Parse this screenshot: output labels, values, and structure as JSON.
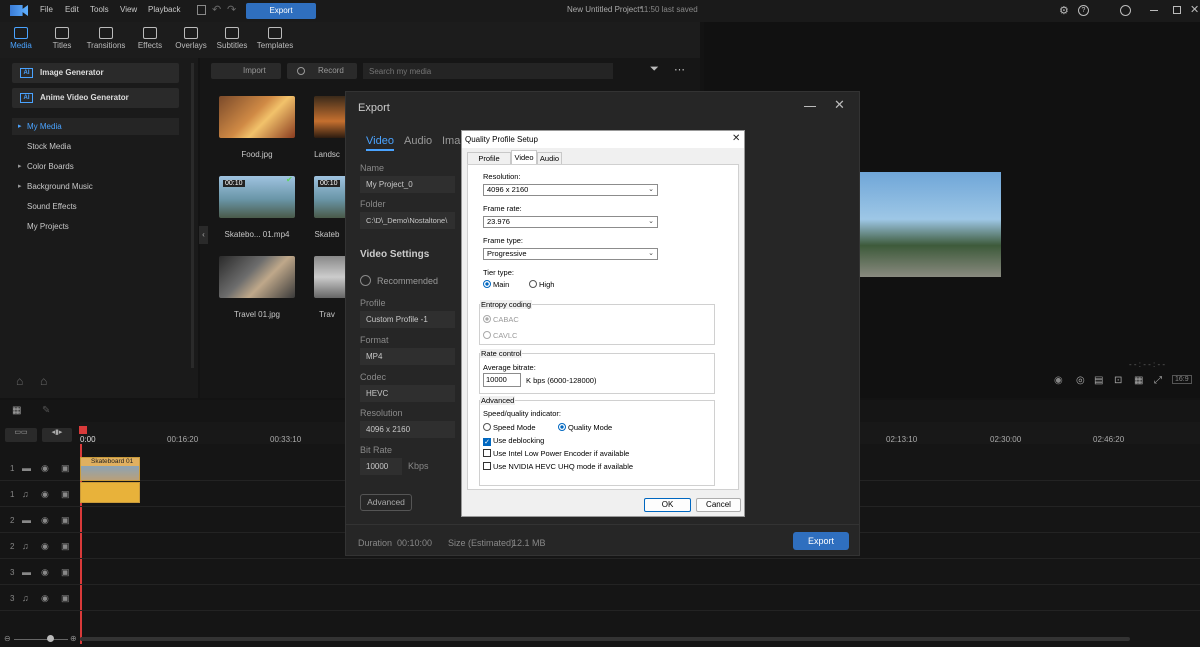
{
  "menubar": {
    "file": "File",
    "edit": "Edit",
    "tools": "Tools",
    "view": "View",
    "playback": "Playback",
    "export": "Export",
    "title": "New Untitled Project*",
    "saved": "11:50 last saved"
  },
  "tabs": [
    {
      "label": "Media"
    },
    {
      "label": "Titles"
    },
    {
      "label": "Transitions"
    },
    {
      "label": "Effects"
    },
    {
      "label": "Overlays"
    },
    {
      "label": "Subtitles"
    },
    {
      "label": "Templates"
    }
  ],
  "left": {
    "image_gen": "Image Generator",
    "anime_gen": "Anime Video Generator",
    "ai_badge": "AI",
    "nav": [
      "My Media",
      "Stock Media",
      "Color Boards",
      "Background Music",
      "Sound Effects",
      "My Projects"
    ]
  },
  "media": {
    "import": "Import",
    "record": "Record",
    "search_placeholder": "Search my media",
    "items": [
      {
        "name": "Food.jpg"
      },
      {
        "name": "Landsc"
      },
      {
        "name": "Skatebo... 01.mp4",
        "duration": "00:10"
      },
      {
        "name": "Skateb",
        "duration": "00:10"
      },
      {
        "name": "Travel 01.jpg"
      },
      {
        "name": "Trav"
      }
    ]
  },
  "timeline": {
    "times": [
      "0:00",
      "00:16:20",
      "00:33:10",
      "02:13:10",
      "02:30:00",
      "02:46:20"
    ],
    "clip": "Skateboard 01",
    "tracks": [
      "1",
      "1",
      "2",
      "2",
      "3",
      "3"
    ]
  },
  "export_dialog": {
    "title": "Export",
    "tabs": [
      "Video",
      "Audio",
      "Ima"
    ],
    "name_label": "Name",
    "name_value": "My Project_0",
    "folder_label": "Folder",
    "folder_value": "C:\\D\\_Demo\\Nostaltone\\",
    "video_settings": "Video Settings",
    "recommended": "Recommended",
    "profile_label": "Profile",
    "profile_value": "Custom Profile -1",
    "format_label": "Format",
    "format_value": "MP4",
    "codec_label": "Codec",
    "codec_value": "HEVC",
    "resolution_label": "Resolution",
    "resolution_value": "4096 x 2160",
    "bitrate_label": "Bit Rate",
    "bitrate_value": "10000",
    "bitrate_unit": "Kbps",
    "advanced": "Advanced",
    "duration_label": "Duration",
    "duration_value": "00:10:00",
    "size_label": "Size (Estimated)",
    "size_value": "12.1 MB",
    "export_button": "Export"
  },
  "qps": {
    "title": "Quality Profile Setup",
    "tabs": [
      "Profile Name",
      "Video",
      "Audio"
    ],
    "resolution_label": "Resolution:",
    "resolution": "4096 x 2160",
    "framerate_label": "Frame rate:",
    "framerate": "23.976",
    "frametype_label": "Frame type:",
    "frametype": "Progressive",
    "tier_label": "Tier type:",
    "tier_main": "Main",
    "tier_high": "High",
    "entropy_label": "Entropy coding",
    "cabac": "CABAC",
    "cavlc": "CAVLC",
    "rate_label": "Rate control",
    "avg_label": "Average bitrate:",
    "avg_value": "10000",
    "avg_unit": "K bps (6000-128000)",
    "advanced_label": "Advanced",
    "speed_label": "Speed/quality indicator:",
    "speed_mode": "Speed Mode",
    "quality_mode": "Quality Mode",
    "deblock": "Use deblocking",
    "intel": "Use Intel Low Power Encoder if available",
    "nvidia": "Use NVIDIA HEVC UHQ mode if available",
    "ok": "OK",
    "cancel": "Cancel"
  }
}
